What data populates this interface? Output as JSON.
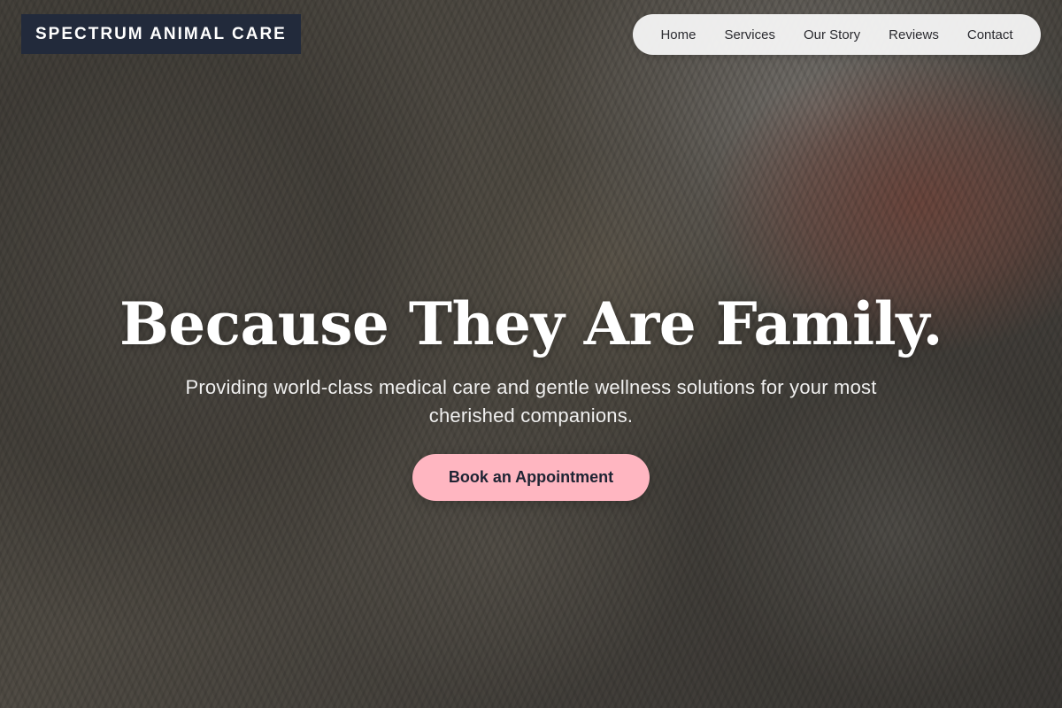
{
  "brand": {
    "name": "SPECTRUM ANIMAL CARE"
  },
  "nav": {
    "items": [
      {
        "label": "Home"
      },
      {
        "label": "Services"
      },
      {
        "label": "Our Story"
      },
      {
        "label": "Reviews"
      },
      {
        "label": "Contact"
      }
    ]
  },
  "hero": {
    "headline": "Because They Are Family.",
    "subtitle": "Providing world-class medical care and gentle wellness solutions for your most cherished companions.",
    "cta_label": "Book an Appointment",
    "background_description_icon": "cats-cuddling-photo"
  },
  "colors": {
    "brand_bg": "#222a3b",
    "nav_bg": "#f5f5f5",
    "cta_bg": "#ffb6c1",
    "cta_text": "#1f2433",
    "headline": "#ffffff"
  }
}
